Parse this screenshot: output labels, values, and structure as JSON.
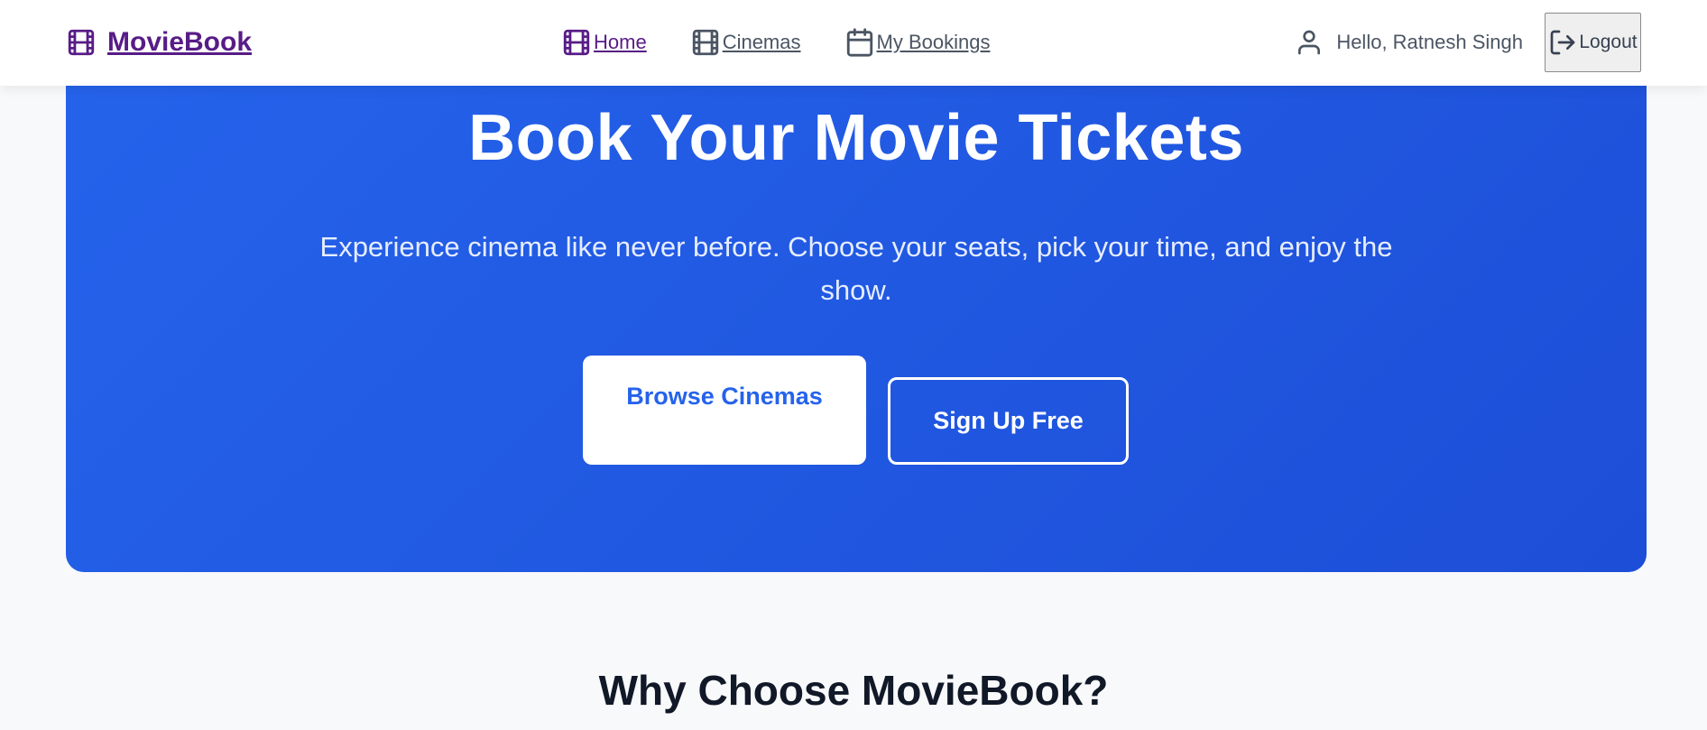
{
  "header": {
    "brand": {
      "label": "MovieBook",
      "icon": "film-icon",
      "color": "#581c87"
    },
    "nav": {
      "items": [
        {
          "label": "Home",
          "icon": "film-icon",
          "active": true
        },
        {
          "label": "Cinemas",
          "icon": "film-icon",
          "active": false
        },
        {
          "label": "My Bookings",
          "icon": "calendar-icon",
          "active": false
        }
      ]
    },
    "user": {
      "icon": "user-icon",
      "greeting": "Hello, Ratnesh Singh"
    },
    "logout": {
      "label": "Logout",
      "icon": "logout-icon"
    }
  },
  "hero": {
    "title": "Book Your Movie Tickets",
    "subtitle": "Experience cinema like never before. Choose your seats, pick your time, and enjoy the show.",
    "primary_button": "Browse Cinemas",
    "secondary_button": "Sign Up Free",
    "background_color": "#2563eb"
  },
  "features": {
    "title": "Why Choose MovieBook?"
  }
}
